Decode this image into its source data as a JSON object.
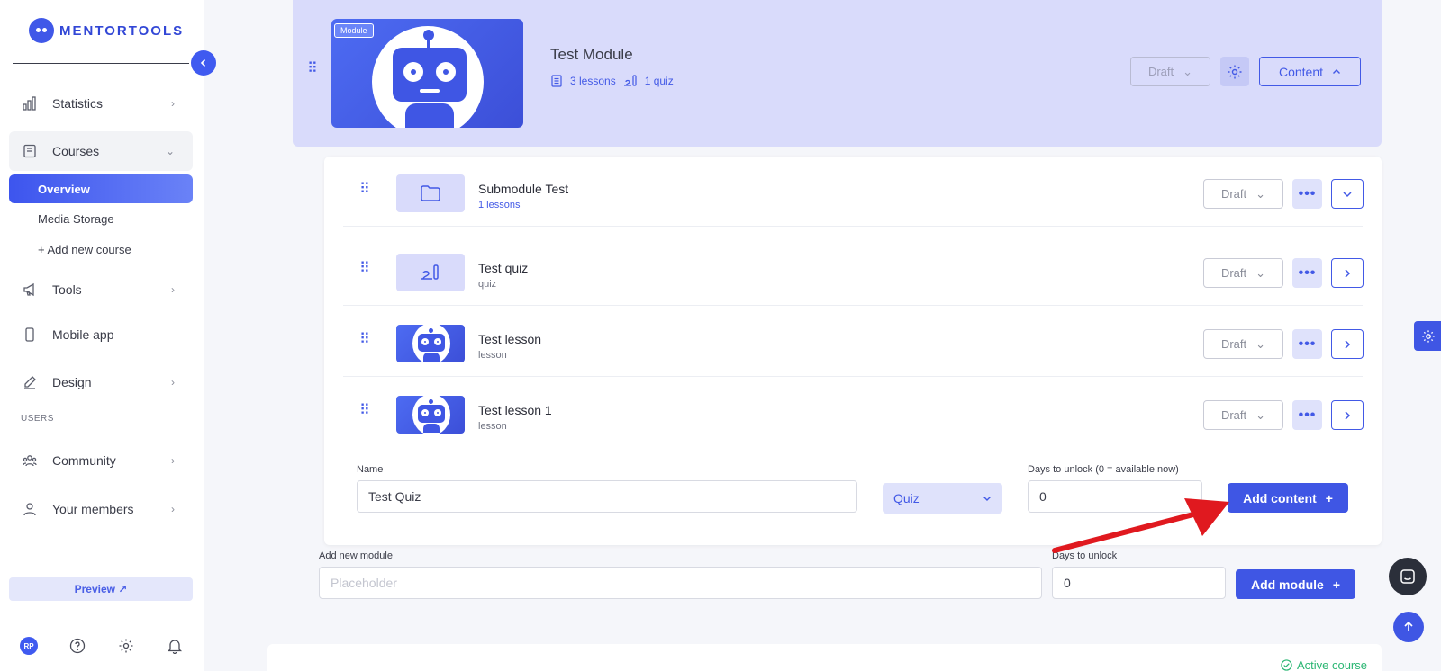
{
  "brand": {
    "name": "MENTORTOOLS"
  },
  "sidebar": {
    "items": [
      {
        "label": "Statistics",
        "icon": "bar-chart-icon"
      },
      {
        "label": "Courses",
        "icon": "book-icon"
      },
      {
        "label": "Tools",
        "icon": "megaphone-icon"
      },
      {
        "label": "Mobile app",
        "icon": "phone-icon"
      },
      {
        "label": "Design",
        "icon": "pencil-icon"
      },
      {
        "label": "Community",
        "icon": "people-icon"
      },
      {
        "label": "Your members",
        "icon": "user-icon"
      }
    ],
    "courses_sub": [
      "Overview",
      "Media Storage",
      "+ Add new course"
    ],
    "section_users": "USERS",
    "preview_label": "Preview ↗",
    "avatar_initials": "RP"
  },
  "module": {
    "badge": "Module",
    "title": "Test Module",
    "lessons": "3 lessons",
    "quizzes": "1 quiz",
    "status": "Draft",
    "content_label": "Content"
  },
  "rows": [
    {
      "title": "Submodule Test",
      "subtitle": "1 lessons",
      "status": "Draft",
      "kind": "folder"
    },
    {
      "title": "Test quiz",
      "subtitle": "quiz",
      "status": "Draft",
      "kind": "quiz"
    },
    {
      "title": "Test lesson",
      "subtitle": "lesson",
      "status": "Draft",
      "kind": "lesson"
    },
    {
      "title": "Test lesson 1",
      "subtitle": "lesson",
      "status": "Draft",
      "kind": "lesson"
    }
  ],
  "add_content": {
    "name_label": "Name",
    "name_value": "Test Quiz",
    "type_value": "Quiz",
    "days_label": "Days to unlock (0 = available now)",
    "days_value": "0",
    "button_label": "Add content"
  },
  "add_module": {
    "label": "Add new module",
    "placeholder": "Placeholder",
    "days_label": "Days to unlock",
    "days_value": "0",
    "button_label": "Add module"
  },
  "course_status": "Active course",
  "colors": {
    "accent": "#3f56e4",
    "module_bg": "#d9dbfb",
    "success": "#2bb673",
    "annotation": "#e0191f"
  }
}
